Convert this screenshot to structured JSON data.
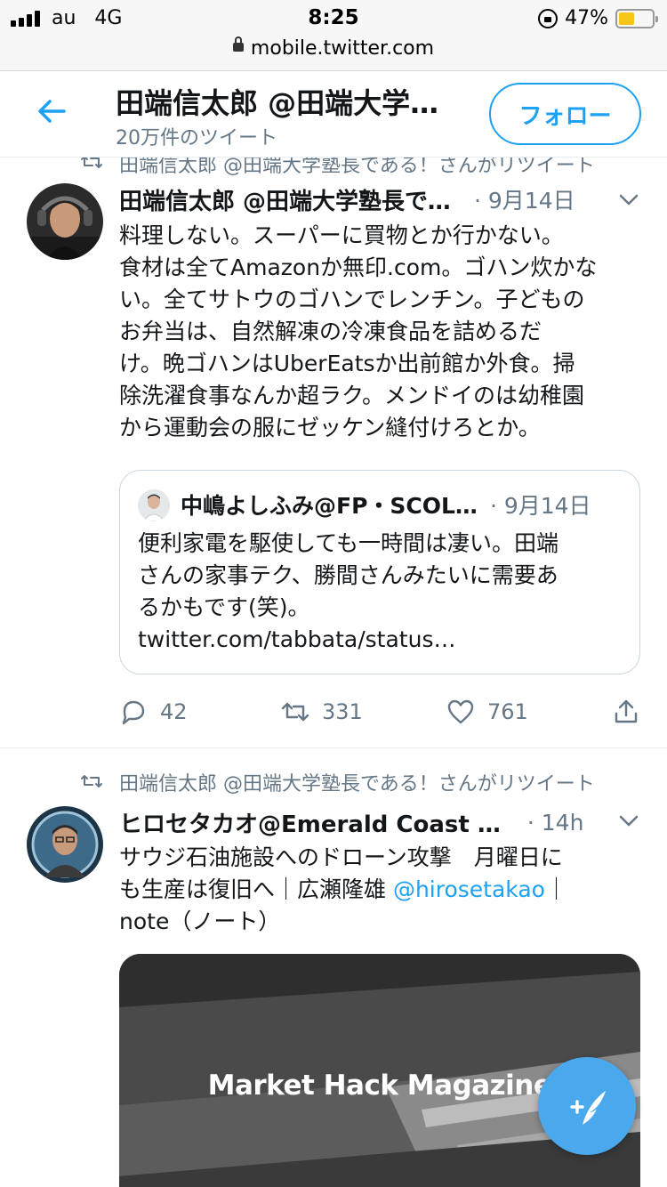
{
  "status_bar": {
    "carrier": "au",
    "network": "4G",
    "time": "8:25",
    "battery_percent": "47%",
    "battery_level": 0.47,
    "battery_color": "#f5c518"
  },
  "browser": {
    "url": "mobile.twitter.com"
  },
  "header": {
    "title": "田端信太郎 @田端大学塾長である！",
    "subtitle": "20万件のツイート",
    "follow_label": "フォロー",
    "accent": "#1da1f2"
  },
  "tweets": [
    {
      "retweet_label": "田端信太郎 @田端大学塾長である！さんがリツイート",
      "name": "田端信太郎 @田端大学塾長である！",
      "time": "· 9月14日",
      "text_lines": [
        "料理しない。スーパーに買物とか行かない。",
        "食材は全てAmazonか無印.com。ゴハン炊かな",
        "い。全てサトウのゴハンでレンチン。子どもの",
        "お弁当は、自然解凍の冷凍食品を詰めるだ",
        "け。晩ゴハンはUberEatsか出前館か外食。掃",
        "除洗濯食事なんか超ラク。メンドイのは幼稚園",
        "から運動会の服にゼッケン縫付けろとか。"
      ],
      "quote": {
        "name": "中嶋よしふみ@FP・SCOL…",
        "time": "· 9月14日",
        "text_lines": [
          "便利家電を駆使しても一時間は凄い。田端",
          "さんの家事テク、勝間さんみたいに需要あ",
          "るかもです(笑)。",
          "twitter.com/tabbata/status…"
        ]
      },
      "reply_count": "42",
      "retweet_count": "331",
      "like_count": "761"
    },
    {
      "retweet_label": "田端信太郎 @田端大学塾長である！さんがリツイート",
      "name": "ヒロセタカオ@Emerald Coast …",
      "time": "· 14h",
      "text_line1": "サウジ石油施設へのドローン攻撃　月曜日に",
      "text_line2_prefix": "も生産は復旧へ｜広瀬隆雄 ",
      "mention": "@hirosetakao",
      "text_line2_suffix": "｜",
      "text_line3": "note（ノート）",
      "media_text": "Market Hack Magazine"
    }
  ]
}
